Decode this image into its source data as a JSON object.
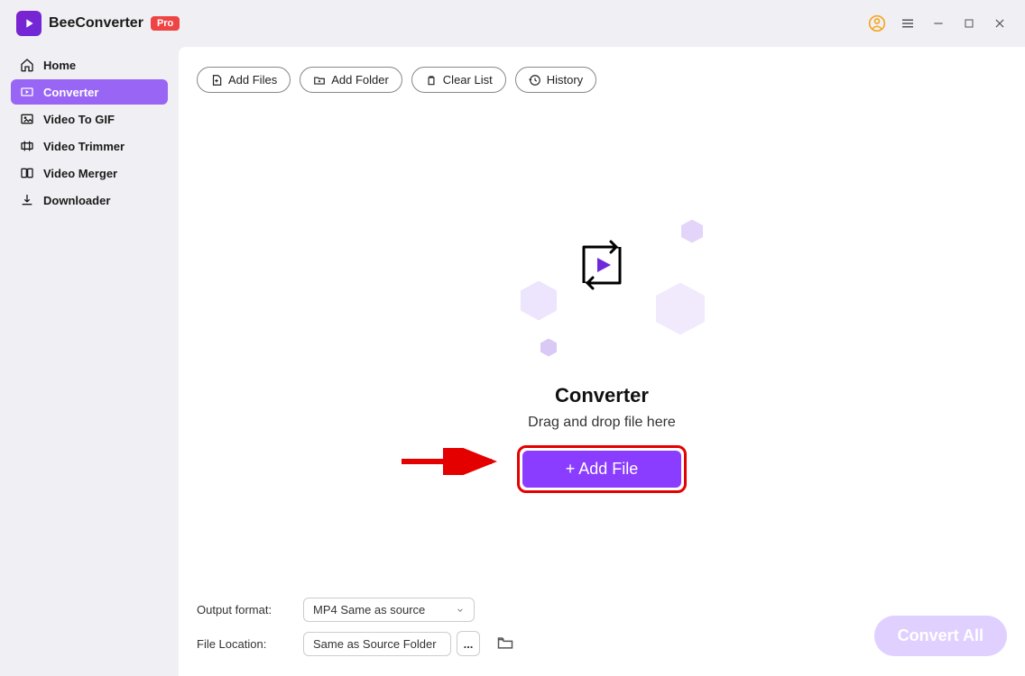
{
  "header": {
    "app_name": "BeeConverter",
    "badge": "Pro"
  },
  "sidebar": {
    "items": [
      {
        "label": "Home"
      },
      {
        "label": "Converter"
      },
      {
        "label": "Video To GIF"
      },
      {
        "label": "Video Trimmer"
      },
      {
        "label": "Video Merger"
      },
      {
        "label": "Downloader"
      }
    ]
  },
  "toolbar": {
    "add_files": "Add Files",
    "add_folder": "Add Folder",
    "clear_list": "Clear List",
    "history": "History"
  },
  "center": {
    "title": "Converter",
    "subtitle": "Drag and drop file here",
    "add_file_btn": "+ Add File"
  },
  "bottom": {
    "format_label": "Output format:",
    "format_value": "MP4 Same as source",
    "location_label": "File Location:",
    "location_value": "Same as Source Folder",
    "more": "...",
    "convert_all": "Convert All"
  }
}
